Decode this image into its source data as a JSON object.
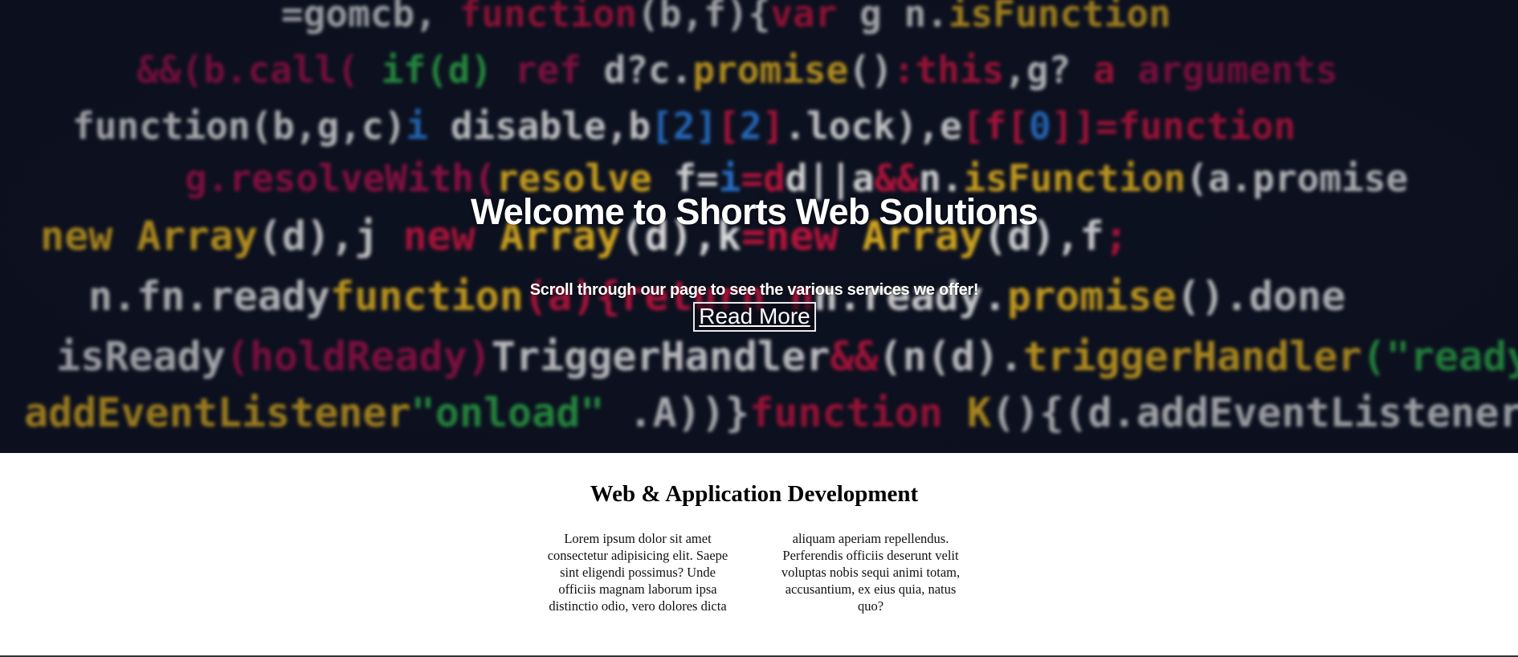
{
  "hero": {
    "title": "Welcome to Shorts Web Solutions",
    "subtitle": "Scroll through our page to see the various services we offer!",
    "cta_label": "Read More",
    "background": "blurred-code-photo"
  },
  "services": {
    "heading": "Web & Application Development",
    "col1_lines": [
      "Lorem ipsum dolor sit amet",
      "consectetur adipisicing elit. Saepe",
      "sint eligendi possimus? Unde",
      "officiis magnam laborum ipsa",
      "distinctio odio, vero dolores dicta"
    ],
    "col2_lines": [
      "aliquam aperiam repellendus.",
      "Perferendis officiis deserunt velit",
      "voluptas nobis sequi animi totam,",
      "accusantium, ex eius quia, natus",
      "quo?"
    ]
  },
  "colors": {
    "hero_text": "#ffffff",
    "page_background": "#ffffff",
    "body_text": "#000000"
  }
}
